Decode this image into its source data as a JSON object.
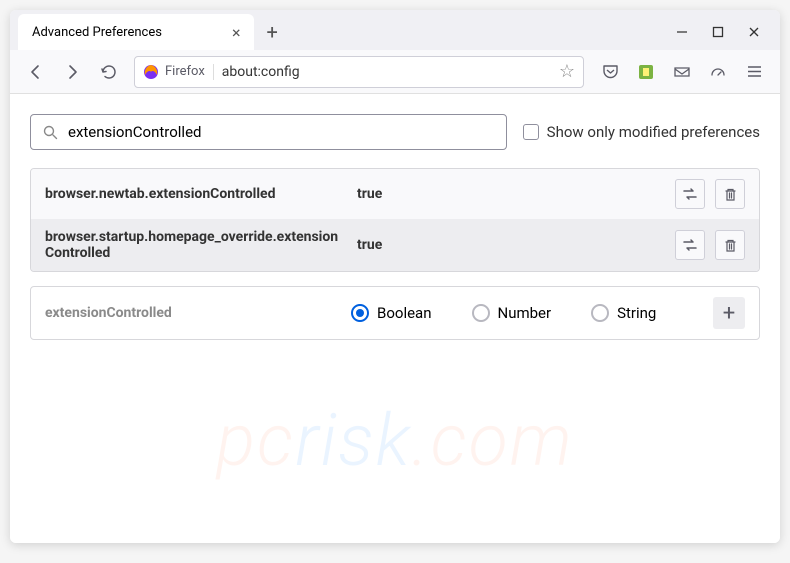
{
  "window": {
    "tab_title": "Advanced Preferences"
  },
  "toolbar": {
    "brand": "Firefox",
    "url": "about:config"
  },
  "search": {
    "value": "extensionControlled",
    "checkbox_label": "Show only modified preferences"
  },
  "prefs": [
    {
      "name": "browser.newtab.extensionControlled",
      "value": "true"
    },
    {
      "name": "browser.startup.homepage_override.extensionControlled",
      "value": "true"
    }
  ],
  "new_pref": {
    "name": "extensionControlled",
    "types": [
      "Boolean",
      "Number",
      "String"
    ],
    "selected": "Boolean"
  },
  "watermark": {
    "a": "pc",
    "b": "risk",
    "c": ".com"
  }
}
